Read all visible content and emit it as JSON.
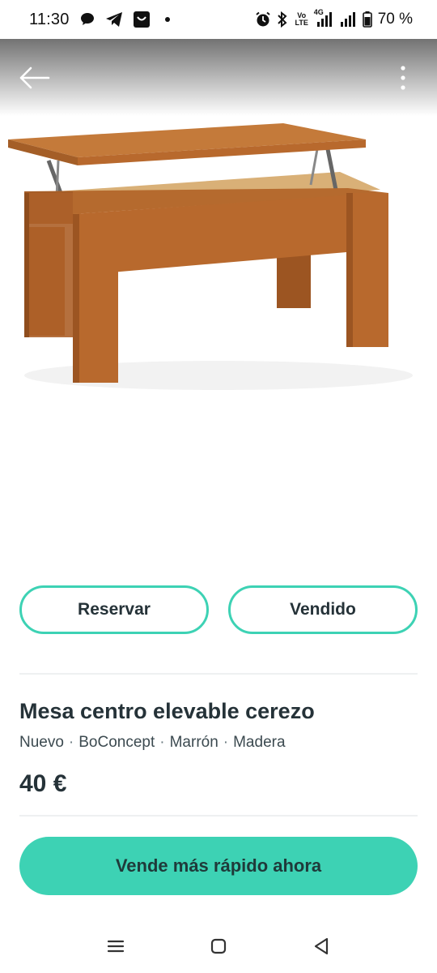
{
  "status_bar": {
    "time": "11:30",
    "battery": "70 %",
    "left_icons": [
      "message-bubble-icon",
      "telegram-icon",
      "shopping-bag-icon",
      "dot-icon"
    ],
    "right_icons": [
      "alarm-icon",
      "bluetooth-icon",
      "volte-icon",
      "4g-signal-icon",
      "signal-icon",
      "battery-icon"
    ],
    "volte_label": "Vo LTE",
    "network_label": "4G"
  },
  "hero": {
    "image_name": "coffee-table-photo",
    "back_icon": "arrow-left-icon",
    "more_icon": "more-vertical-icon"
  },
  "actions": {
    "reserve_label": "Reservar",
    "sold_label": "Vendido"
  },
  "product": {
    "title": "Mesa centro elevable cerezo",
    "attributes": [
      "Nuevo",
      "BoConcept",
      "Marrón",
      "Madera"
    ],
    "separator": "·",
    "price": "40 €"
  },
  "cta": {
    "label": "Vende más rápido ahora"
  },
  "colors": {
    "accent": "#3dd2b4",
    "text": "#253238",
    "wood": "#b8692d"
  }
}
